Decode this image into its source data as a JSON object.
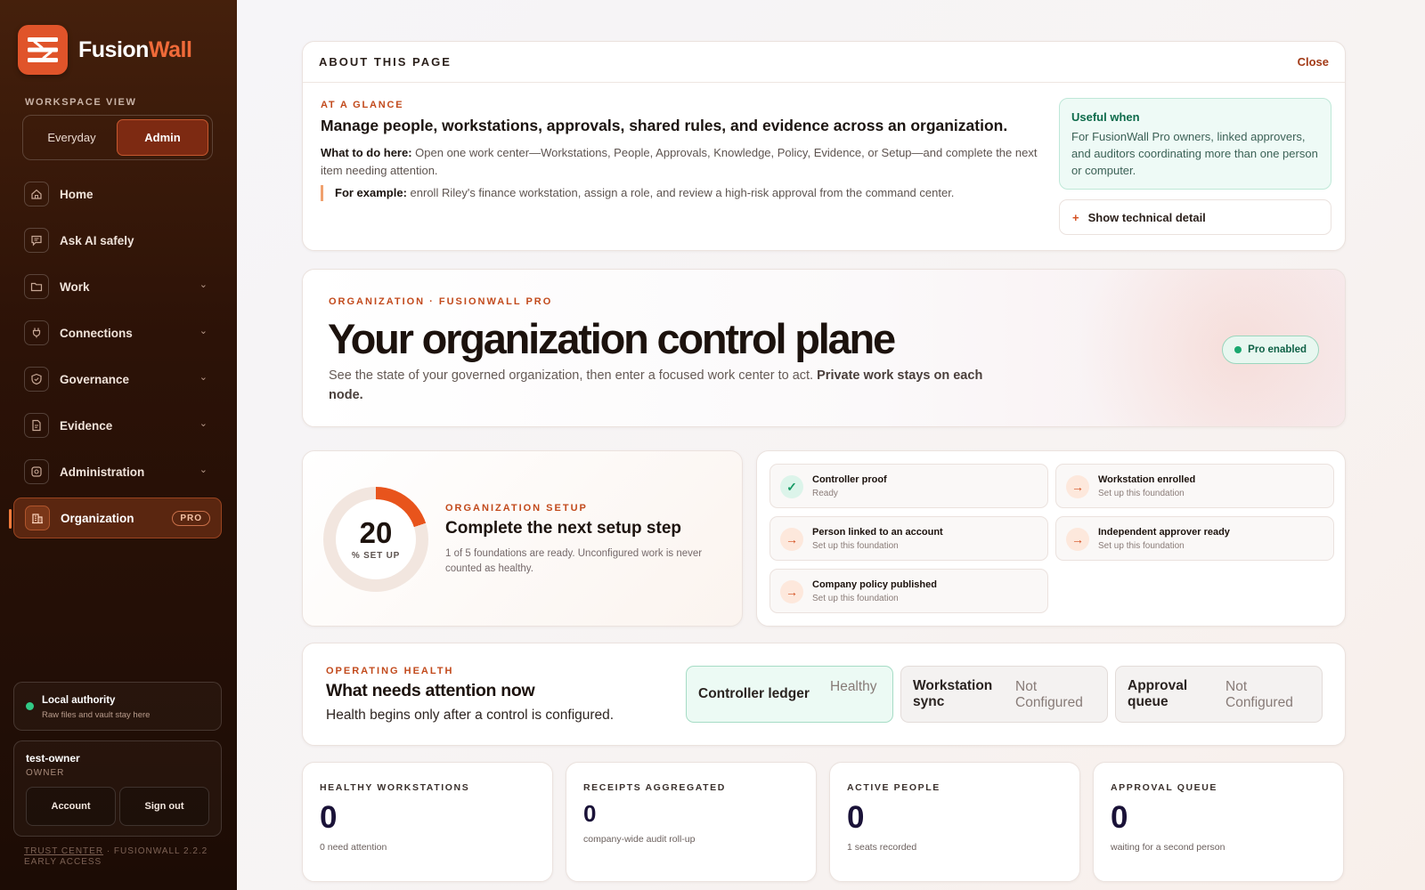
{
  "brand": {
    "name_part1": "Fusion",
    "name_part2": "Wall"
  },
  "workspace": {
    "label": "WORKSPACE VIEW",
    "options": [
      "Everyday",
      "Admin"
    ],
    "selected": "Admin"
  },
  "nav": {
    "home": "Home",
    "ask": "Ask AI safely",
    "work": "Work",
    "connections": "Connections",
    "governance": "Governance",
    "evidence": "Evidence",
    "administration": "Administration",
    "organization": "Organization",
    "pro": "PRO"
  },
  "authority": {
    "title": "Local authority",
    "subtitle": "Raw files and vault stay here",
    "status_color": "#32c986"
  },
  "user": {
    "name": "test-owner",
    "role": "OWNER",
    "account": "Account",
    "signout": "Sign out"
  },
  "footer": {
    "trust": "TRUST CENTER",
    "version": " · FUSIONWALL 2.2.2 EARLY ACCESS"
  },
  "about": {
    "title": "ABOUT THIS PAGE",
    "close": "Close",
    "glance_label": "AT A GLANCE",
    "heading": "Manage people, workstations, approvals, shared rules, and evidence across an organization.",
    "todo_label": "What to do here:",
    "todo_text": " Open one work center—Workstations, People, Approvals, Knowledge, Policy, Evidence, or Setup—and complete the next item needing attention.",
    "example_label": "For example:",
    "example_text": " enroll Riley's finance workstation, assign a role, and review a high-risk approval from the command center.",
    "useful_title": "Useful when",
    "useful_text": "For FusionWall Pro owners, linked approvers, and auditors coordinating more than one person or computer.",
    "tech_btn": "Show technical detail"
  },
  "hero": {
    "eyebrow": "ORGANIZATION · FUSIONWALL PRO",
    "title": "Your organization control plane",
    "desc": "See the state of your governed organization, then enter a focused work center to act. ",
    "desc_bold": "Private work stays on each node.",
    "pill": "Pro enabled"
  },
  "setup": {
    "percent": "20",
    "percent_value": 20,
    "unit": "% SET UP",
    "eyebrow": "ORGANIZATION SETUP",
    "heading": "Complete the next setup step",
    "desc": "1 of 5 foundations are ready. Unconfigured work is never counted as healthy."
  },
  "foundations": [
    {
      "title": "Controller proof",
      "status": "Ready",
      "ok": true
    },
    {
      "title": "Workstation enrolled",
      "status": "Set up this foundation",
      "ok": false
    },
    {
      "title": "Person linked to an account",
      "status": "Set up this foundation",
      "ok": false
    },
    {
      "title": "Independent approver ready",
      "status": "Set up this foundation",
      "ok": false
    },
    {
      "title": "Company policy published",
      "status": "Set up this foundation",
      "ok": false
    }
  ],
  "health": {
    "eyebrow": "OPERATING HEALTH",
    "heading": "What needs attention now",
    "desc": "Health begins only after a control is configured.",
    "tiles": [
      {
        "name": "Controller ledger",
        "status": "Healthy"
      },
      {
        "name": "Workstation sync",
        "status": "Not Configured"
      },
      {
        "name": "Approval queue",
        "status": "Not Configured"
      }
    ]
  },
  "stats": [
    {
      "label": "HEALTHY WORKSTATIONS",
      "value": "0",
      "caption": "0 need attention"
    },
    {
      "label": "RECEIPTS AGGREGATED",
      "value": "0",
      "caption": "company-wide audit roll-up"
    },
    {
      "label": "ACTIVE PEOPLE",
      "value": "0",
      "caption": "1 seats recorded"
    },
    {
      "label": "APPROVAL QUEUE",
      "value": "0",
      "caption": "waiting for a second person"
    }
  ]
}
